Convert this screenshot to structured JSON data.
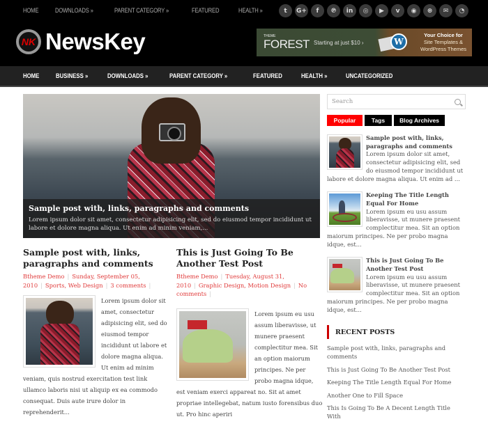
{
  "top_nav": [
    {
      "label": "HOME"
    },
    {
      "label": "DOWNLOADS »"
    },
    {
      "label": "PARENT CATEGORY »"
    },
    {
      "label": "FEATURED"
    },
    {
      "label": "HEALTH »"
    }
  ],
  "social": [
    {
      "name": "twitter-icon",
      "glyph": "t"
    },
    {
      "name": "google-plus-icon",
      "glyph": "G+"
    },
    {
      "name": "facebook-icon",
      "glyph": "f"
    },
    {
      "name": "pinterest-icon",
      "glyph": "℗"
    },
    {
      "name": "linkedin-icon",
      "glyph": "in"
    },
    {
      "name": "instagram-icon",
      "glyph": "◎"
    },
    {
      "name": "youtube-icon",
      "glyph": "▶"
    },
    {
      "name": "vimeo-icon",
      "glyph": "v"
    },
    {
      "name": "github-icon",
      "glyph": "◉"
    },
    {
      "name": "dribbble-icon",
      "glyph": "⊛"
    },
    {
      "name": "email-icon",
      "glyph": "✉"
    },
    {
      "name": "rss-icon",
      "glyph": "◔"
    }
  ],
  "brand": {
    "logo_mark": "NK",
    "name": "NewsKey",
    "accent": "#e03a3a"
  },
  "banner": {
    "small": "THEME",
    "brand": "FOREST",
    "tagline": "Starting at just $10 ›",
    "badge": "W",
    "right_title": "Your Choice for",
    "right_line1": "Site Templates &",
    "right_line2": "WordPress Themes"
  },
  "main_nav": [
    {
      "label": "HOME"
    },
    {
      "label": "BUSINESS »"
    },
    {
      "label": "DOWNLOADS »"
    },
    {
      "label": "PARENT CATEGORY »"
    },
    {
      "label": "FEATURED"
    },
    {
      "label": "HEALTH »"
    },
    {
      "label": "UNCATEGORIZED"
    }
  ],
  "hero": {
    "title": "Sample post with, links, paragraphs and comments",
    "excerpt": "Lorem ipsum dolor sit amet, consectetur adipisicing elit, sed do eiusmod tempor incididunt ut labore et dolore magna aliqua. Ut enim ad minim veniam,..."
  },
  "posts": [
    {
      "title": "Sample post with, links, paragraphs and comments",
      "author": "Btheme Demo",
      "date": "Sunday, September 05, 2010",
      "categories": "Sports, Web Design",
      "comments": "3 comments",
      "excerpt": "Lorem ipsum dolor sit amet, consectetur adipisicing elit, sed do eiusmod tempor incididunt ut labore et dolore magna aliqua. Ut enim ad minim veniam, quis nostrud exercitation test link ullamco laboris nisi ut aliquip ex ea commodo consequat. Duis aute irure dolor in reprehenderit..."
    },
    {
      "title": "This is Just Going To Be Another Test Post",
      "author": "Btheme Demo",
      "date": "Tuesday, August 31, 2010",
      "categories": "Graphic Design, Motion Design",
      "comments": "No comments",
      "excerpt": "Lorem ipsum eu usu assum liberavisse, ut munere praesent complectitur mea. Sit an option maiorum principes. Ne per probo magna idque, est veniam exerci appareat no. Sit at amet propriae intellegebat, natum iusto forensibus duo ut. Pro hinc aperiri"
    }
  ],
  "sidebar": {
    "search_placeholder": "Search",
    "tabs": [
      {
        "label": "Popular",
        "active": true
      },
      {
        "label": "Tags",
        "active": false
      },
      {
        "label": "Blog Archives",
        "active": false
      }
    ],
    "popular": [
      {
        "title": "Sample post with, links, paragraphs and comments",
        "excerpt": "Lorem ipsum dolor sit amet, consectetur adipisicing elit, sed do eiusmod tempor incididunt ut labore et dolore magna aliqua. Ut enim ad ..."
      },
      {
        "title": "Keeping The Title Length Equal For Home",
        "excerpt": "Lorem ipsum eu usu assum liberavisse, ut munere praesent complectitur mea. Sit an option maiorum principes. Ne per probo magna idque, est..."
      },
      {
        "title": "This is Just Going To Be Another Test Post",
        "excerpt": "Lorem ipsum eu usu assum liberavisse, ut munere praesent complectitur mea. Sit an option maiorum principes. Ne per probo magna idque, est..."
      }
    ],
    "recent_title": "RECENT POSTS",
    "recent": [
      {
        "label": "Sample post with, links, paragraphs and comments"
      },
      {
        "label": "This is Just Going To Be Another Test Post"
      },
      {
        "label": "Keeping The Title Length Equal For Home"
      },
      {
        "label": "Another One to Fill Space"
      },
      {
        "label": "This Is Going To Be A Decent Length Title With"
      }
    ]
  }
}
